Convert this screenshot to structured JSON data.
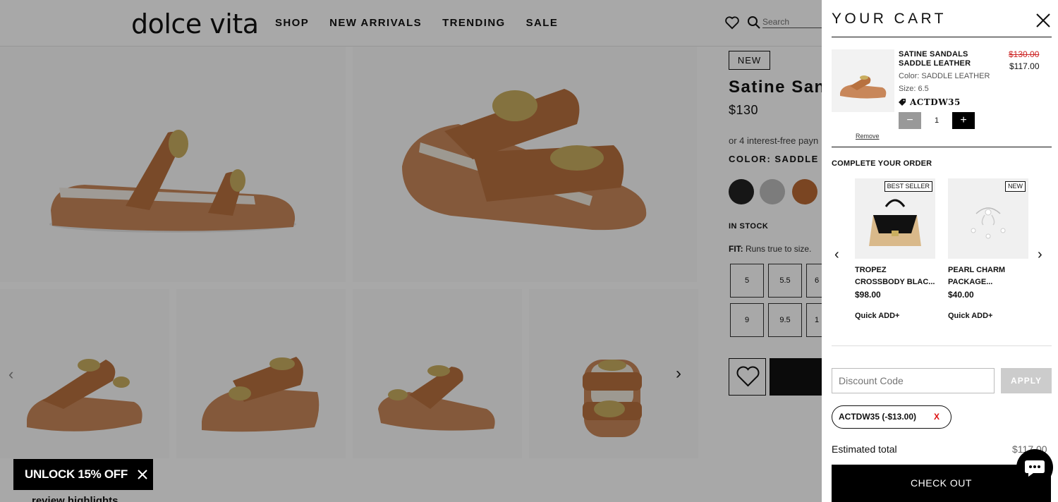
{
  "header": {
    "logo": "dolce vita",
    "nav": [
      "SHOP",
      "NEW ARRIVALS",
      "TRENDING",
      "SALE"
    ],
    "search_placeholder": "Search"
  },
  "product": {
    "badge": "NEW",
    "title": "Satine San",
    "price": "$130",
    "installments": "or 4 interest-free payn",
    "color_label": "COLOR: SADDLE LE",
    "swatches": [
      "#222222",
      "#bdbdbd",
      "#b96a34"
    ],
    "stock": "IN STOCK",
    "fit_label": "FIT:",
    "fit_text": "Runs true to size.",
    "sizes_row1": [
      "5",
      "5.5",
      "6"
    ],
    "sizes_row2": [
      "9",
      "9.5",
      "1"
    ]
  },
  "promo": {
    "unlock": "UNLOCK 15% OFF",
    "review_highlights": "review highlights"
  },
  "cart": {
    "title": "YOUR CART",
    "item": {
      "name": "SATINE SANDALS SADDLE LEATHER",
      "old_price": "$130.00",
      "price": "$117.00",
      "color": "Color: SADDLE LEATHER",
      "size": "Size: 6.5",
      "code": "ACTDW35",
      "qty": "1",
      "remove": "Remove"
    },
    "upsell": {
      "title": "COMPLETE YOUR ORDER",
      "items": [
        {
          "badge": "BEST SELLER",
          "name1": "TROPEZ",
          "name2": "CROSSBODY BLAC...",
          "price": "$98.00",
          "add": "Quick ADD+"
        },
        {
          "badge": "NEW",
          "name1": "PEARL CHARM",
          "name2": "PACKAGE...",
          "price": "$40.00",
          "add": "Quick ADD+"
        }
      ]
    },
    "discount_placeholder": "Discount Code",
    "apply": "APPLY",
    "applied_code": "ACTDW35 (-$13.00)",
    "applied_remove": "X",
    "estimated_label": "Estimated total",
    "estimated_value": "$117.00",
    "checkout": "CHECK OUT"
  },
  "colors": {
    "accent": "#000000",
    "sale_red": "#cc2222",
    "leather": "#b87447"
  }
}
